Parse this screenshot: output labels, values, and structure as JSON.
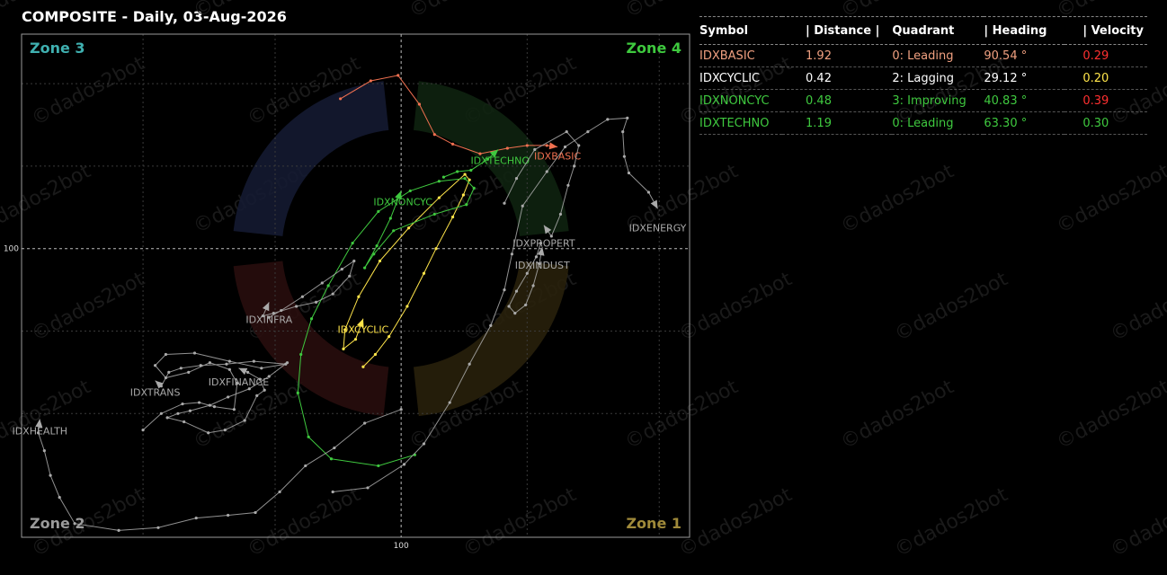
{
  "title": "COMPOSITE - Daily, 03-Aug-2026",
  "watermark": "©dados2bot",
  "chart_data": {
    "type": "scatter",
    "subtype": "relative-rotation-graph",
    "xaxis_tick": "100",
    "yaxis_tick": "100",
    "zones": [
      {
        "label": "Zone 3",
        "position": "top-left",
        "color": "#3fb0b0"
      },
      {
        "label": "Zone 4",
        "position": "top-right",
        "color": "#3ec93e"
      },
      {
        "label": "Zone 2",
        "position": "bottom-left",
        "color": "#9a9a9a"
      },
      {
        "label": "Zone 1",
        "position": "bottom-right",
        "color": "#a08a3a"
      }
    ],
    "series": [
      {
        "name": "IDXBASIC",
        "color": "#f07050",
        "highlight": true,
        "points": [
          [
            96,
            110.9
          ],
          [
            98,
            112.2
          ],
          [
            99.8,
            112.6
          ],
          [
            101.2,
            110.5
          ],
          [
            102.2,
            108.3
          ],
          [
            103.4,
            107.6
          ],
          [
            105.2,
            106.9
          ],
          [
            107,
            107.3
          ],
          [
            108.3,
            107.5
          ],
          [
            109.6,
            107.5
          ],
          [
            110.3,
            107.4
          ]
        ]
      },
      {
        "name": "IDXCYCLIC",
        "color": "#ffe54a",
        "highlight": true,
        "points": [
          [
            97.5,
            91.4
          ],
          [
            98.3,
            92.3
          ],
          [
            99.2,
            93.6
          ],
          [
            100.4,
            95.8
          ],
          [
            101.5,
            98.2
          ],
          [
            102.3,
            100
          ],
          [
            103.4,
            102.3
          ],
          [
            104.1,
            103.9
          ],
          [
            104.5,
            105
          ],
          [
            104.2,
            105.4
          ],
          [
            102.5,
            103.7
          ],
          [
            100.5,
            101.5
          ],
          [
            98.6,
            99.1
          ],
          [
            97.2,
            96.5
          ],
          [
            96.3,
            94.1
          ],
          [
            96.2,
            92.7
          ],
          [
            97,
            93.4
          ],
          [
            97.5,
            94.9
          ]
        ]
      },
      {
        "name": "IDXNONCYC",
        "color": "#3fc93f",
        "highlight": true,
        "points": [
          [
            100.9,
            85
          ],
          [
            98.5,
            84.2
          ],
          [
            95.4,
            84.7
          ],
          [
            93.9,
            86.3
          ],
          [
            93.2,
            89.5
          ],
          [
            93.4,
            92.3
          ],
          [
            94.1,
            94.9
          ],
          [
            95.2,
            97.3
          ],
          [
            96.8,
            100.4
          ],
          [
            98.5,
            102.7
          ],
          [
            100.6,
            104.2
          ],
          [
            102.5,
            104.9
          ],
          [
            104.2,
            105.1
          ],
          [
            104.8,
            104.4
          ],
          [
            104.3,
            103.2
          ],
          [
            102.2,
            102.5
          ],
          [
            99.5,
            101.3
          ],
          [
            98.2,
            99.6
          ],
          [
            97.6,
            98.6
          ],
          [
            98.4,
            100.2
          ],
          [
            99.3,
            102.2
          ],
          [
            100,
            104.2
          ]
        ]
      },
      {
        "name": "IDXTECHNO",
        "color": "#3fc93f",
        "highlight": true,
        "points": [
          [
            102.8,
            105.2
          ],
          [
            103.7,
            105.6
          ],
          [
            104.6,
            105.7
          ],
          [
            105.7,
            106.5
          ],
          [
            106.4,
            107.2
          ]
        ]
      },
      {
        "name": "IDXENERGY",
        "color": "#aaaaaa",
        "highlight": false,
        "points": [
          [
            95.5,
            82.3
          ],
          [
            97.8,
            82.6
          ],
          [
            100.2,
            84.3
          ],
          [
            101.5,
            85.8
          ],
          [
            103.2,
            88.8
          ],
          [
            104.5,
            91.6
          ],
          [
            105.9,
            94.4
          ],
          [
            106.8,
            97
          ],
          [
            107.3,
            99.6
          ],
          [
            108,
            103.1
          ],
          [
            109.6,
            105.6
          ],
          [
            110.8,
            107.4
          ],
          [
            112.3,
            108.5
          ],
          [
            113.6,
            109.4
          ],
          [
            114.9,
            109.5
          ],
          [
            114.6,
            108.5
          ],
          [
            114.7,
            106.7
          ],
          [
            115,
            105.5
          ],
          [
            116.3,
            104.1
          ],
          [
            116.9,
            102.9
          ]
        ]
      },
      {
        "name": "IDXPROPERT",
        "color": "#aaaaaa",
        "highlight": false,
        "points": [
          [
            106.8,
            103.3
          ],
          [
            107.6,
            105.1
          ],
          [
            108.8,
            107.2
          ],
          [
            110.9,
            108.5
          ],
          [
            111.7,
            107.5
          ],
          [
            111.4,
            106
          ],
          [
            111,
            104.6
          ],
          [
            110.5,
            102.5
          ],
          [
            109.9,
            100.9
          ],
          [
            109.4,
            101.7
          ]
        ]
      },
      {
        "name": "IDXINDUST",
        "color": "#aaaaaa",
        "highlight": false,
        "points": [
          [
            109.2,
            100.4
          ],
          [
            108.9,
            99.4
          ],
          [
            108.3,
            98.2
          ],
          [
            107.6,
            96.9
          ],
          [
            107.1,
            95.8
          ],
          [
            107.5,
            95.3
          ],
          [
            108.2,
            95.9
          ],
          [
            108.7,
            97.3
          ],
          [
            109.1,
            98.9
          ],
          [
            109.3,
            100.1
          ]
        ]
      },
      {
        "name": "IDXINFRA",
        "color": "#aaaaaa",
        "highlight": false,
        "points": [
          [
            91.3,
            95
          ],
          [
            92.1,
            95.5
          ],
          [
            93.5,
            96.5
          ],
          [
            94.8,
            97.5
          ],
          [
            96.1,
            98.5
          ],
          [
            96.9,
            99.1
          ],
          [
            96.6,
            98
          ],
          [
            95.5,
            96.7
          ],
          [
            94.4,
            96.1
          ],
          [
            93.1,
            95.8
          ],
          [
            91.6,
            95.3
          ],
          [
            90.9,
            95.1
          ],
          [
            91.3,
            96.1
          ]
        ]
      },
      {
        "name": "IDXFINANCE",
        "color": "#aaaaaa",
        "highlight": false,
        "points": [
          [
            92.5,
            91.7
          ],
          [
            91.3,
            90.7
          ],
          [
            90,
            89.8
          ],
          [
            88.6,
            89.2
          ],
          [
            87.4,
            88.6
          ],
          [
            86.1,
            88.2
          ],
          [
            85.3,
            88
          ],
          [
            84.6,
            87.7
          ],
          [
            85.7,
            87.4
          ],
          [
            87.3,
            86.6
          ],
          [
            88.4,
            86.8
          ],
          [
            89.7,
            87.5
          ],
          [
            90.5,
            89.3
          ],
          [
            91,
            89.7
          ],
          [
            90.7,
            90.5
          ],
          [
            89.9,
            91
          ],
          [
            89.3,
            91.3
          ]
        ]
      },
      {
        "name": "IDXTRANS",
        "color": "#aaaaaa",
        "highlight": false,
        "points": [
          [
            83,
            86.8
          ],
          [
            84.2,
            88
          ],
          [
            85.6,
            88.7
          ],
          [
            86.7,
            88.8
          ],
          [
            87.7,
            88.5
          ],
          [
            89,
            88.3
          ],
          [
            89.2,
            90.2
          ],
          [
            88.7,
            91.2
          ],
          [
            87.4,
            91.7
          ],
          [
            86,
            91
          ],
          [
            84.5,
            90.6
          ],
          [
            83.8,
            91.5
          ],
          [
            84.5,
            92.3
          ],
          [
            86.4,
            92.4
          ],
          [
            88.7,
            91.8
          ],
          [
            90.8,
            91.3
          ],
          [
            92.4,
            91.6
          ],
          [
            90.3,
            91.8
          ],
          [
            88.5,
            91.6
          ],
          [
            86.8,
            91.5
          ],
          [
            85.5,
            91.3
          ],
          [
            84.7,
            91
          ],
          [
            84.2,
            90
          ],
          [
            83.8,
            90.4
          ]
        ]
      },
      {
        "name": "IDXHEALTH",
        "color": "#aaaaaa",
        "highlight": false,
        "points": [
          [
            100,
            88.3
          ],
          [
            97.6,
            87.3
          ],
          [
            95.6,
            85.5
          ],
          [
            93.7,
            84.2
          ],
          [
            92,
            82.3
          ],
          [
            90.4,
            80.8
          ],
          [
            88.6,
            80.6
          ],
          [
            86.5,
            80.4
          ],
          [
            84,
            79.7
          ],
          [
            81.4,
            79.5
          ],
          [
            78.5,
            80
          ],
          [
            77.5,
            81.9
          ],
          [
            76.9,
            83.5
          ],
          [
            76.5,
            85.3
          ],
          [
            76.1,
            86.6
          ],
          [
            76.2,
            87.6
          ]
        ]
      }
    ]
  },
  "table": {
    "headers": [
      "Symbol",
      "| Distance |",
      "Quadrant",
      "| Heading",
      "| Velocity"
    ],
    "rows": [
      {
        "symbol": "IDXBASIC",
        "distance": "1.92",
        "quadrant": "0: Leading",
        "heading": "90.54 °",
        "velocity": "0.29",
        "text_color": "#f0a080",
        "velocity_color": "#ff3030"
      },
      {
        "symbol": "IDXCYCLIC",
        "distance": "0.42",
        "quadrant": "2: Lagging",
        "heading": "29.12 °",
        "velocity": "0.20",
        "text_color": "#ffffff",
        "velocity_color": "#ffe54a"
      },
      {
        "symbol": "IDXNONCYC",
        "distance": "0.48",
        "quadrant": "3: Improving",
        "heading": "40.83 °",
        "velocity": "0.39",
        "text_color": "#3fc93f",
        "velocity_color": "#ff3030"
      },
      {
        "symbol": "IDXTECHNO",
        "distance": "1.19",
        "quadrant": "0: Leading",
        "heading": "63.30 °",
        "velocity": "0.30",
        "text_color": "#3fc93f",
        "velocity_color": "#3fc93f"
      }
    ]
  }
}
